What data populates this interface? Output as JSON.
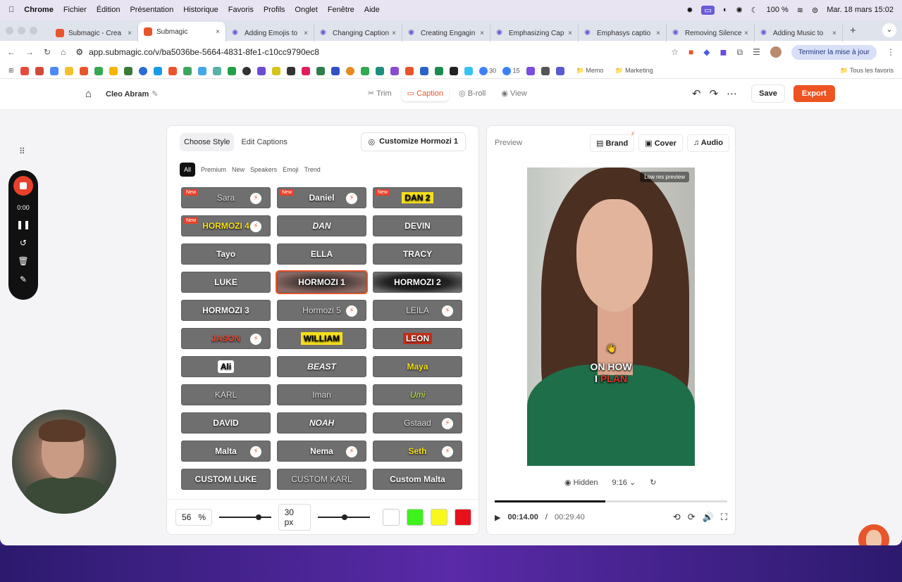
{
  "macos": {
    "app": "Chrome",
    "menu": [
      "Fichier",
      "Édition",
      "Présentation",
      "Historique",
      "Favoris",
      "Profils",
      "Onglet",
      "Fenêtre",
      "Aide"
    ],
    "battery": "100 %",
    "datetime": "Mar. 18 mars  15:02"
  },
  "browser": {
    "tabs": [
      {
        "title": "Submagic - Crea",
        "active": false,
        "fav": "submagic"
      },
      {
        "title": "Submagic",
        "active": true,
        "fav": "submagic"
      },
      {
        "title": "Adding Emojis to",
        "active": false,
        "fav": "gear"
      },
      {
        "title": "Changing Caption",
        "active": false,
        "fav": "gear"
      },
      {
        "title": "Creating Engagin",
        "active": false,
        "fav": "gear"
      },
      {
        "title": "Emphasizing Cap",
        "active": false,
        "fav": "gear"
      },
      {
        "title": "Emphasys captio",
        "active": false,
        "fav": "gear"
      },
      {
        "title": "Removing Silence",
        "active": false,
        "fav": "gear"
      },
      {
        "title": "Adding Music to",
        "active": false,
        "fav": "gear"
      }
    ],
    "url": "app.submagic.co/v/ba5036be-5664-4831-8fe1-c10cc9790ec8",
    "update_button": "Terminer la mise à jour",
    "bookmarks_numbers": [
      "30",
      "15"
    ],
    "bookmark_folders": [
      "Memo",
      "Marketing"
    ],
    "all_bookmarks": "Tous les favoris"
  },
  "app": {
    "project_name": "Cleo Abram",
    "modes": [
      {
        "label": "Trim",
        "active": false
      },
      {
        "label": "Caption",
        "active": true
      },
      {
        "label": "B-roll",
        "active": false
      },
      {
        "label": "View",
        "active": false
      }
    ],
    "save_label": "Save",
    "export_label": "Export"
  },
  "recorder": {
    "time": "0:00"
  },
  "left_panel": {
    "tabs": [
      "Choose Style",
      "Edit Captions"
    ],
    "active_tab": "Choose Style",
    "customize_label": "Customize Hormozi 1",
    "filters": [
      "All",
      "Premium",
      "New",
      "Speakers",
      "Emoji",
      "Trend"
    ],
    "styles": [
      {
        "label": "Sara",
        "new": true,
        "bolt": true,
        "variant": "thin"
      },
      {
        "label": "Daniel",
        "new": true,
        "bolt": true,
        "variant": "plain"
      },
      {
        "label": "DAN 2",
        "new": true,
        "bolt": false,
        "variant": "y"
      },
      {
        "label": "HORMOZI 4",
        "new": true,
        "bolt": true,
        "variant": "yellowtxt"
      },
      {
        "label": "DAN",
        "new": false,
        "bolt": false,
        "variant": "italic"
      },
      {
        "label": "DEVIN",
        "new": false,
        "bolt": false,
        "variant": "plain"
      },
      {
        "label": "Tayo",
        "new": false,
        "bolt": false,
        "variant": "plain"
      },
      {
        "label": "ELLA",
        "new": false,
        "bolt": false,
        "variant": "plain"
      },
      {
        "label": "TRACY",
        "new": false,
        "bolt": false,
        "variant": "plain"
      },
      {
        "label": "LUKE",
        "new": false,
        "bolt": false,
        "variant": "plain"
      },
      {
        "label": "HORMOZI 1",
        "new": false,
        "bolt": false,
        "variant": "sel"
      },
      {
        "label": "HORMOZI 2",
        "new": false,
        "bolt": false,
        "variant": "black"
      },
      {
        "label": "HORMOZI 3",
        "new": false,
        "bolt": false,
        "variant": "plain"
      },
      {
        "label": "Hormozi 5",
        "new": false,
        "bolt": true,
        "variant": "thin"
      },
      {
        "label": "LEILA",
        "new": false,
        "bolt": true,
        "variant": "thin"
      },
      {
        "label": "JASON",
        "new": false,
        "bolt": true,
        "variant": "orange"
      },
      {
        "label": "WILLIAM",
        "new": false,
        "bolt": false,
        "variant": "ywi"
      },
      {
        "label": "LEON",
        "new": false,
        "bolt": false,
        "variant": "red"
      },
      {
        "label": "Ali",
        "new": false,
        "bolt": false,
        "variant": "wbox"
      },
      {
        "label": "BEAST",
        "new": false,
        "bolt": false,
        "variant": "italic"
      },
      {
        "label": "Maya",
        "new": false,
        "bolt": false,
        "variant": "yellowtxt"
      },
      {
        "label": "KARL",
        "new": false,
        "bolt": false,
        "variant": "thin"
      },
      {
        "label": "Iman",
        "new": false,
        "bolt": false,
        "variant": "thin"
      },
      {
        "label": "Umi",
        "new": false,
        "bolt": false,
        "variant": "lime"
      },
      {
        "label": "DAVID",
        "new": false,
        "bolt": false,
        "variant": "plain"
      },
      {
        "label": "NOAH",
        "new": false,
        "bolt": false,
        "variant": "italic"
      },
      {
        "label": "Gstaad",
        "new": false,
        "bolt": true,
        "variant": "thin"
      },
      {
        "label": "Malta",
        "new": false,
        "bolt": true,
        "variant": "plain"
      },
      {
        "label": "Nema",
        "new": false,
        "bolt": true,
        "variant": "plain"
      },
      {
        "label": "Seth",
        "new": false,
        "bolt": true,
        "variant": "yellowtxt"
      },
      {
        "label": "CUSTOM LUKE",
        "new": false,
        "bolt": false,
        "variant": "plain"
      },
      {
        "label": "CUSTOM KARL",
        "new": false,
        "bolt": false,
        "variant": "thin"
      },
      {
        "label": "Custom Malta",
        "new": false,
        "bolt": false,
        "variant": "plain"
      }
    ],
    "new_badge": "New",
    "position_value": "56",
    "position_unit": "%",
    "position_level": 0.7,
    "size_value": "30 px",
    "size_level": 0.45,
    "colors": [
      "#ffffff",
      "#3ef21b",
      "#f8f81c",
      "#e8111b"
    ]
  },
  "preview": {
    "title": "Preview",
    "buttons": [
      "Brand",
      "Cover",
      "Audio"
    ],
    "low_res": "Low res preview",
    "caption_line1": "ON HOW",
    "caption_line2_a": "I",
    "caption_line2_b": "PLAN",
    "hidden_label": "Hidden",
    "ratio": "9:16",
    "current_time": "00:14.00",
    "separator": "/",
    "total_time": "00:29.40",
    "progress": 0.476
  }
}
